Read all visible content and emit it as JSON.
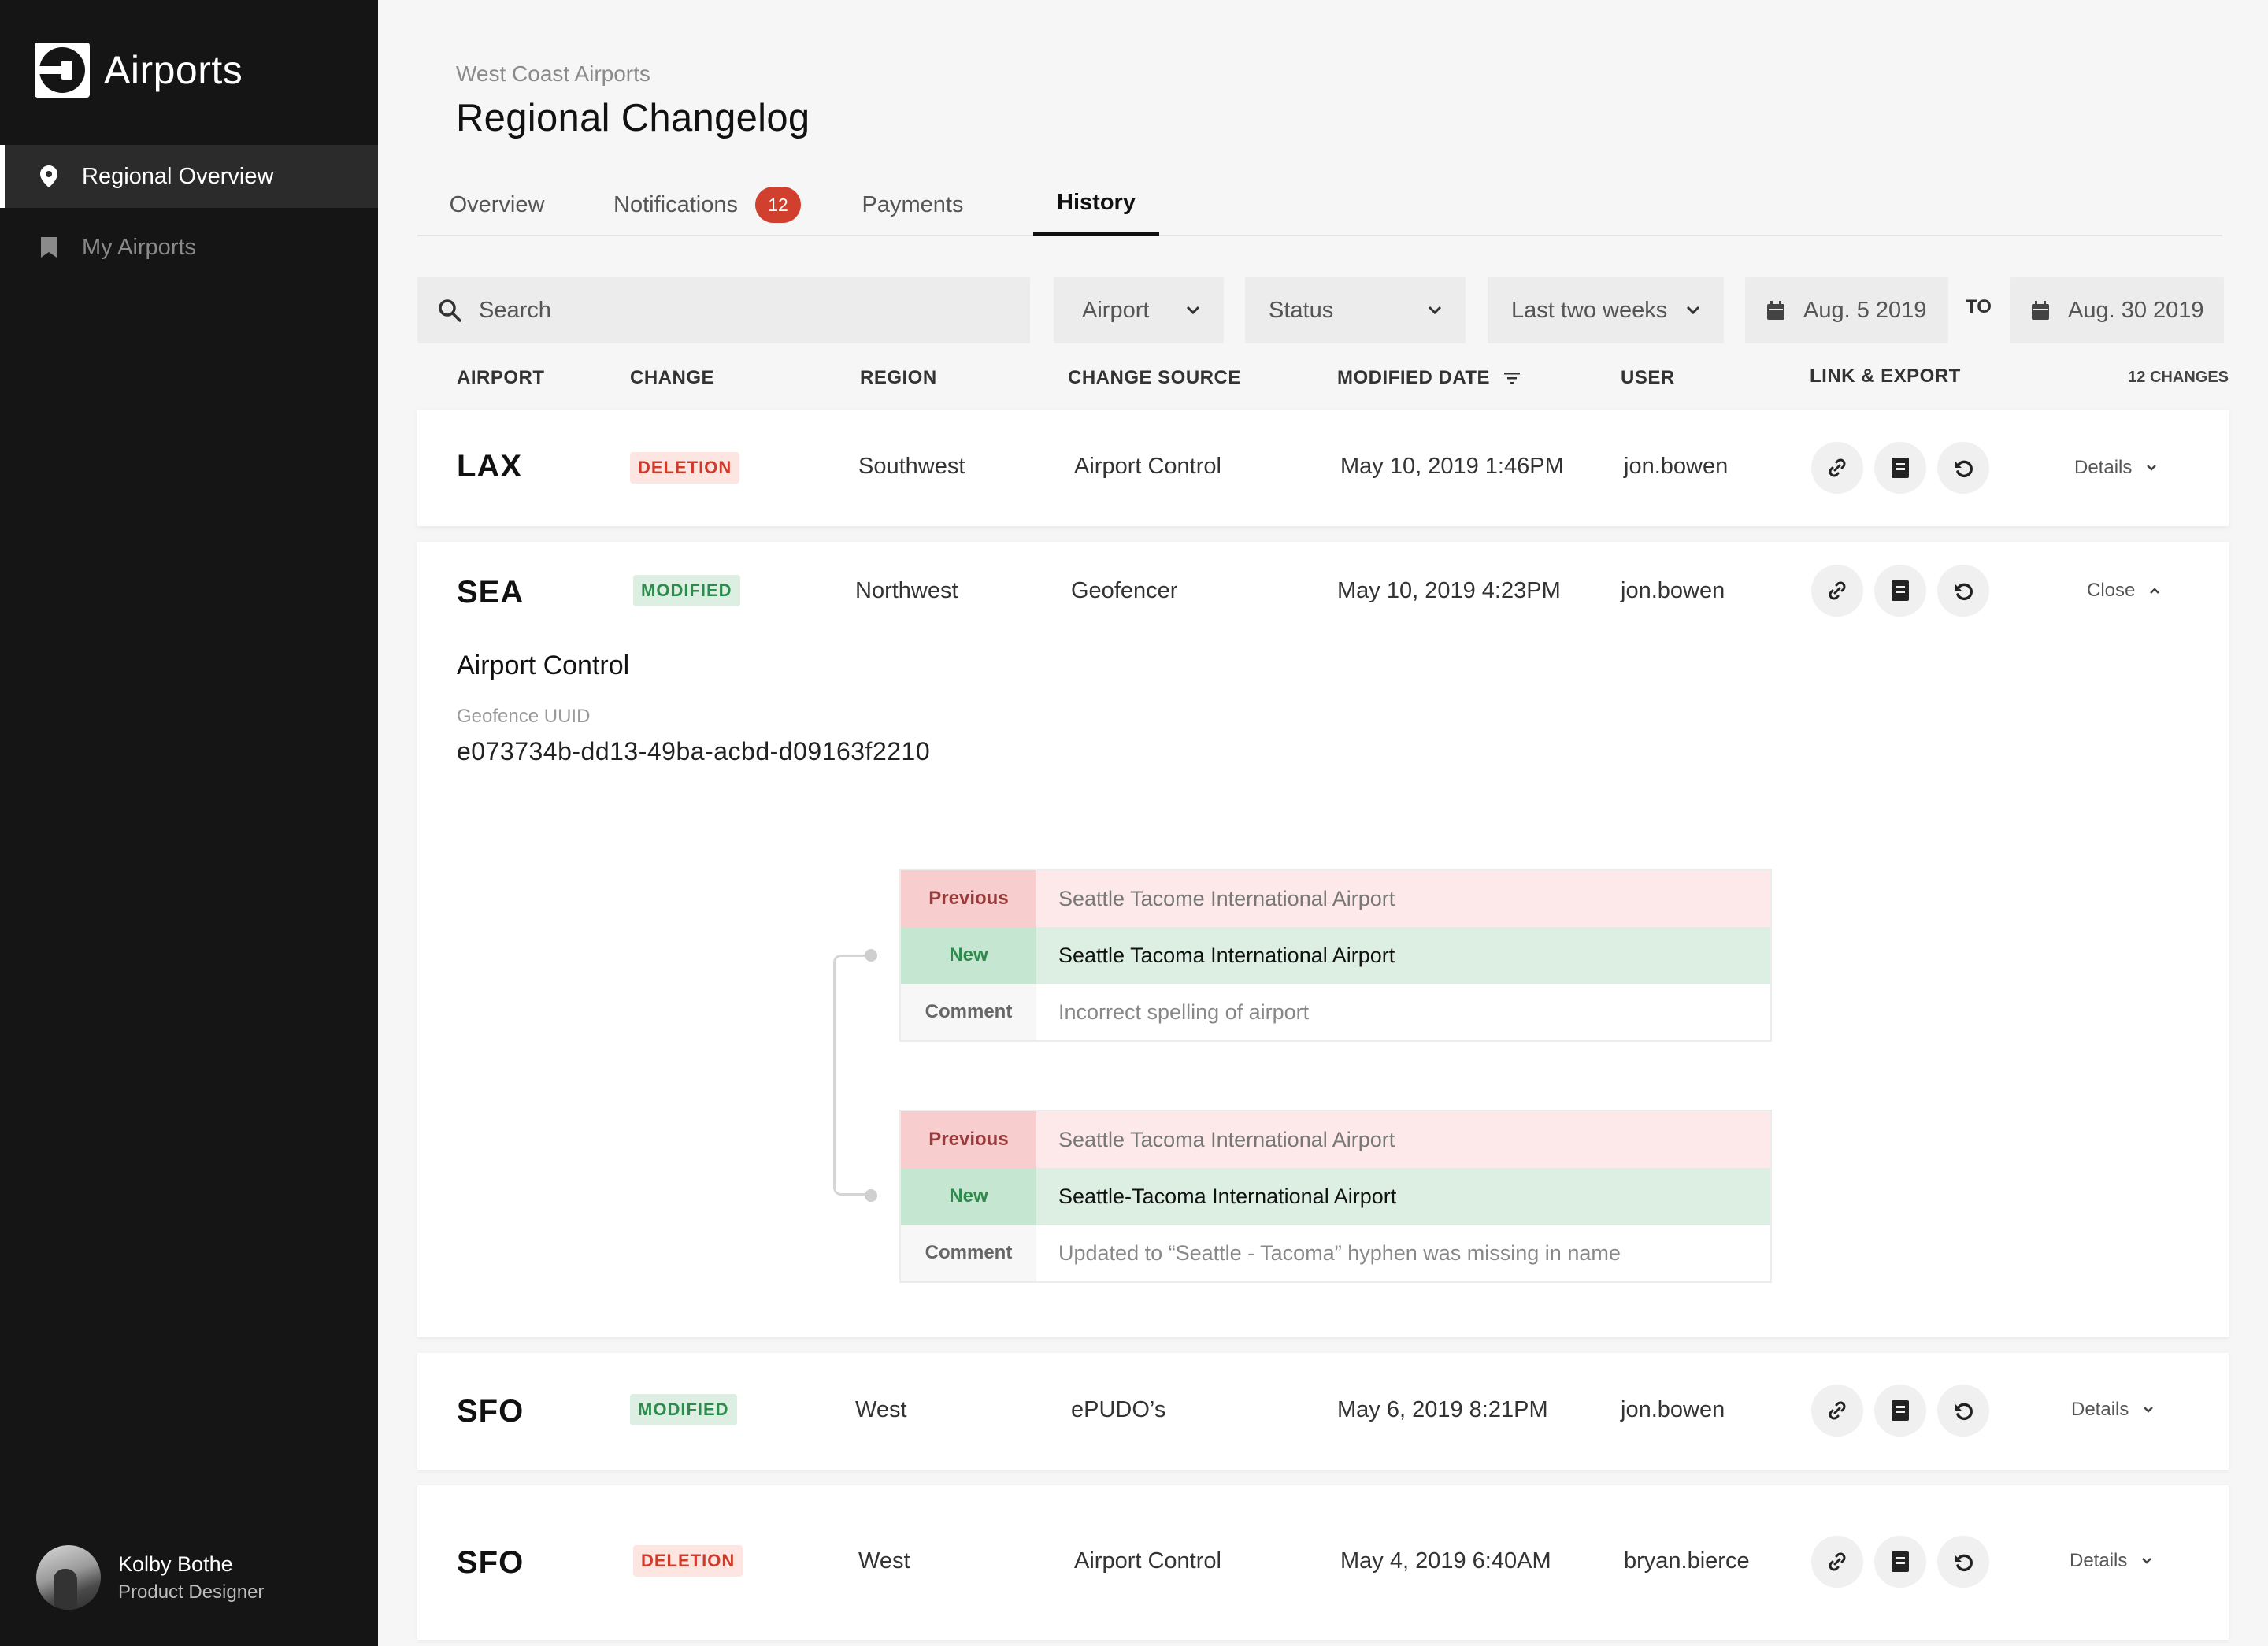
{
  "app": {
    "title": "Airports"
  },
  "sidebar": {
    "items": [
      {
        "label": "Regional Overview",
        "icon": "location-pin-icon",
        "active": true
      },
      {
        "label": "My Airports",
        "icon": "bookmark-icon",
        "active": false
      }
    ],
    "user": {
      "name": "Kolby Bothe",
      "role": "Product Designer"
    }
  },
  "header": {
    "breadcrumb": "West Coast Airports",
    "title": "Regional Changelog",
    "tabs": [
      {
        "label": "Overview"
      },
      {
        "label": "Notifications",
        "badge": "12"
      },
      {
        "label": "Payments"
      },
      {
        "label": "History",
        "active": true
      }
    ]
  },
  "filters": {
    "search_placeholder": "Search",
    "airport": "Airport",
    "status": "Status",
    "range": "Last two weeks",
    "date_from": "Aug. 5 2019",
    "to_label": "TO",
    "date_to": "Aug. 30 2019"
  },
  "table": {
    "headers": {
      "airport": "AIRPORT",
      "change": "CHANGE",
      "region": "REGION",
      "source": "CHANGE SOURCE",
      "modified": "MODIFIED DATE",
      "user": "USER",
      "link": "LINK & EXPORT",
      "count": "12 CHANGES"
    },
    "rows": [
      {
        "code": "LAX",
        "change": "DELETION",
        "region": "Southwest",
        "source": "Airport Control",
        "date": "May 10, 2019 1:46PM",
        "user": "jon.bowen",
        "toggle": "Details"
      },
      {
        "code": "SEA",
        "change": "MODIFIED",
        "region": "Northwest",
        "source": "Geofencer",
        "date": "May 10, 2019 4:23PM",
        "user": "jon.bowen",
        "toggle": "Close"
      },
      {
        "code": "SFO",
        "change": "MODIFIED",
        "region": "West",
        "source": "ePUDO’s",
        "date": "May 6, 2019 8:21PM",
        "user": "jon.bowen",
        "toggle": "Details"
      },
      {
        "code": "SFO",
        "change": "DELETION",
        "region": "West",
        "source": "Airport Control",
        "date": "May 4, 2019 6:40AM",
        "user": "bryan.bierce",
        "toggle": "Details"
      }
    ]
  },
  "detail": {
    "title": "Airport Control",
    "uuid_label": "Geofence UUID",
    "uuid": "e073734b-dd13-49ba-acbd-d09163f2210",
    "changes": [
      {
        "previous_label": "Previous",
        "previous": "Seattle Tacome International Airport",
        "new_label": "New",
        "new": "Seattle Tacoma International Airport",
        "comment_label": "Comment",
        "comment": "Incorrect spelling of airport"
      },
      {
        "previous_label": "Previous",
        "previous": "Seattle Tacoma International Airport",
        "new_label": "New",
        "new": "Seattle-Tacoma International Airport",
        "comment_label": "Comment",
        "comment": "Updated to “Seattle - Tacoma” hyphen was missing in name"
      }
    ]
  },
  "colors": {
    "sidebar_bg": "#151515",
    "badge": "#d13f2f",
    "deletion": "#cf3b2a",
    "modified": "#2f8a4e"
  }
}
